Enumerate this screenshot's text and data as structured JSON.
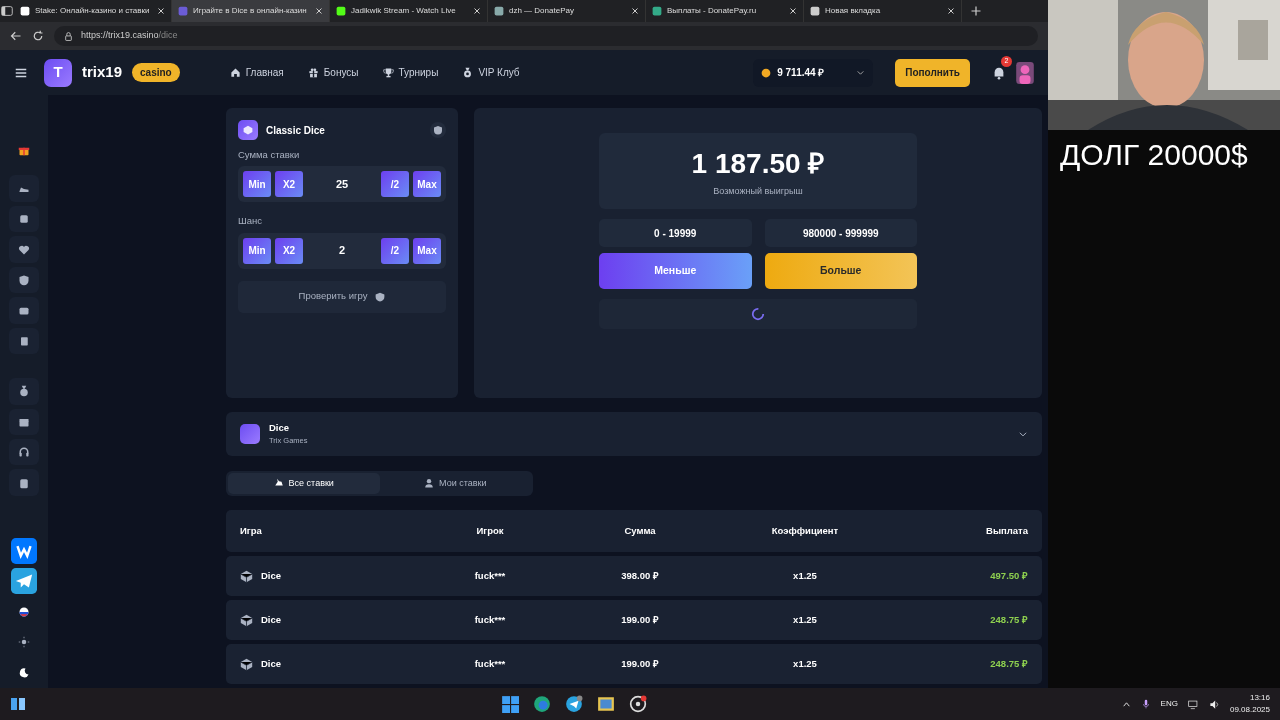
{
  "browser": {
    "tabs": [
      {
        "title": "Stake: Онлайн-казино и ставки",
        "selected": false
      },
      {
        "title": "Играйте в Dice в онлайн-казин",
        "selected": true
      },
      {
        "title": "Jadikwik Stream - Watch Live",
        "selected": false
      },
      {
        "title": "dzh — DonatePay",
        "selected": false
      },
      {
        "title": "Выплаты - DonatePay.ru",
        "selected": false
      },
      {
        "title": "Новая вкладка",
        "selected": false
      }
    ],
    "url_host": "https://trix19.casino",
    "url_path": "/dice"
  },
  "header": {
    "logo_letter": "T",
    "logo_text": "trix19",
    "logo_badge": "casino",
    "nav": [
      {
        "label": "Главная",
        "kind": "home"
      },
      {
        "label": "Бонусы",
        "kind": "gift"
      },
      {
        "label": "Турниры",
        "kind": "cup"
      },
      {
        "label": "VIP Клуб",
        "kind": "medal"
      }
    ],
    "balance": "9 711.44 ₽",
    "deposit": "Пополнить",
    "notifications": "2"
  },
  "game": {
    "title": "Classic Dice",
    "fields": [
      {
        "label": "Сумма ставки",
        "left": [
          "Min",
          "X2"
        ],
        "value": "25",
        "right": [
          "/2",
          "Max"
        ]
      },
      {
        "label": "Шанс",
        "left": [
          "Min",
          "X2"
        ],
        "value": "2",
        "right": [
          "/2",
          "Max"
        ]
      }
    ],
    "verify": "Проверить игру"
  },
  "result": {
    "amount": "1 187.50 ₽",
    "caption": "Возможный выигрыш",
    "ranges": [
      "0 - 19999",
      "980000 - 999999"
    ],
    "bets": [
      {
        "label": "Меньше",
        "kind": "less"
      },
      {
        "label": "Больше",
        "kind": "more"
      }
    ]
  },
  "info": {
    "title": "Dice",
    "subtitle": "Trix Games"
  },
  "bet_tabs": [
    {
      "label": "Все ставки",
      "selected": true
    },
    {
      "label": "Мои ставки",
      "selected": false
    }
  ],
  "table": {
    "columns": [
      "Игра",
      "Игрок",
      "Сумма",
      "Коэффициент",
      "Выплата"
    ],
    "rows": [
      [
        "Dice",
        "fuck***",
        "398.00 ₽",
        "x1.25",
        "497.50 ₽"
      ],
      [
        "Dice",
        "fuck***",
        "199.00 ₽",
        "x1.25",
        "248.75 ₽"
      ],
      [
        "Dice",
        "fuck***",
        "199.00 ₽",
        "x1.25",
        "248.75 ₽"
      ]
    ]
  },
  "overlay_text": "ДОЛГ 20000$",
  "taskbar": {
    "lang": "ENG",
    "time": "13:16",
    "date": "09.08.2025"
  }
}
